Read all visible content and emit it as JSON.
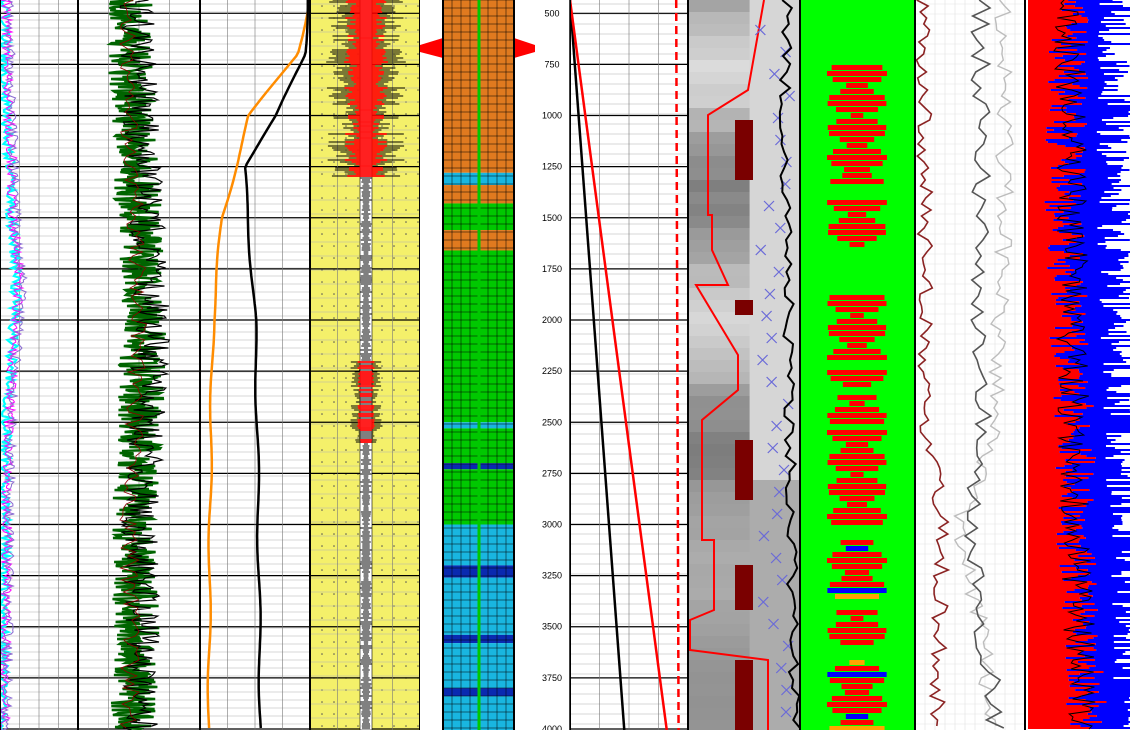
{
  "chart_data": {
    "type": "line",
    "title": "",
    "depth_axis": {
      "ticks": [
        "500",
        "750",
        "1000",
        "1250",
        "1500",
        "1750",
        "2000",
        "2250",
        "2500",
        "2750",
        "3000",
        "3250",
        "3500",
        "3750",
        "4000"
      ],
      "min": 435,
      "max": 4005
    },
    "tracks": [
      {
        "name": "",
        "curve_colors": [
          "#00ffff",
          "#ff00ff",
          "#8a6bd1"
        ],
        "trend": [
          [
            435,
            5
          ],
          [
            1000,
            8
          ],
          [
            1200,
            12
          ],
          [
            1500,
            14
          ],
          [
            1800,
            22
          ],
          [
            2500,
            8
          ],
          [
            3500,
            4
          ],
          [
            4000,
            3
          ]
        ]
      },
      {
        "name": "",
        "curve_colors": [
          "#006400",
          "#000000",
          "#8b0000"
        ],
        "trend": [
          [
            435,
            42
          ],
          [
            1000,
            45
          ],
          [
            1500,
            50
          ],
          [
            2000,
            55
          ],
          [
            2500,
            50
          ],
          [
            3000,
            45
          ],
          [
            3500,
            48
          ],
          [
            4000,
            45
          ]
        ]
      },
      {
        "name": "",
        "curve_colors": [
          "#ff8c00",
          "#000000"
        ],
        "orange": [
          [
            435,
            100
          ],
          [
            700,
            88
          ],
          [
            1000,
            45
          ],
          [
            1500,
            20
          ],
          [
            2000,
            12
          ],
          [
            2500,
            10
          ],
          [
            3000,
            9
          ],
          [
            4000,
            8
          ]
        ],
        "black": [
          [
            435,
            98
          ],
          [
            700,
            95
          ],
          [
            1000,
            70
          ],
          [
            1250,
            40
          ],
          [
            1600,
            45
          ],
          [
            2000,
            50
          ],
          [
            2500,
            52
          ],
          [
            3000,
            53
          ],
          [
            4000,
            55
          ]
        ]
      },
      {
        "name": "",
        "fill": "#f4f06a",
        "curve_colors": [
          "#ff0000",
          "#000000"
        ]
      },
      {
        "name": "",
        "curve_colors": [
          "#e07a1f",
          "#00c800",
          "#19b6e0",
          "#0a2ab0"
        ],
        "lithology": [
          [
            435,
            "#e07a1f"
          ],
          [
            1280,
            "#19b6e0"
          ],
          [
            1340,
            "#e07a1f"
          ],
          [
            1430,
            "#00c800"
          ],
          [
            1560,
            "#e07a1f"
          ],
          [
            1660,
            "#00c800"
          ],
          [
            2500,
            "#19b6e0"
          ],
          [
            2530,
            "#00c800"
          ],
          [
            2700,
            "#0a2ab0"
          ],
          [
            2730,
            "#00c800"
          ],
          [
            3000,
            "#19b6e0"
          ],
          [
            3200,
            "#0a2ab0"
          ],
          [
            3260,
            "#19b6e0"
          ],
          [
            3540,
            "#0a2ab0"
          ],
          [
            3580,
            "#19b6e0"
          ],
          [
            3800,
            "#0a2ab0"
          ],
          [
            3840,
            "#19b6e0"
          ],
          [
            4005,
            "#19b6e0"
          ]
        ]
      },
      {
        "name": "",
        "curve_colors": [
          "#000000",
          "#ff0000"
        ],
        "lines": [
          [
            [
              435,
              0
            ],
            [
              4005,
              0.46
            ]
          ],
          [
            [
              435,
              0
            ],
            [
              4005,
              0.82
            ]
          ],
          [
            [
              435,
              0.9
            ],
            [
              4005,
              0.92
            ]
          ]
        ]
      },
      {
        "name": "",
        "curve_colors": [
          "#ff0000",
          "#000000",
          "#6a6ad8",
          "#8b0000"
        ]
      },
      {
        "name": "",
        "fill": "#00ff00",
        "curve_colors": [
          "#ff0000",
          "#0000ff",
          "#ffa500"
        ]
      },
      {
        "name": "",
        "curve_colors": [
          "#8b2323",
          "#bdbdbd",
          "#555555"
        ]
      },
      {
        "name": "",
        "curve_colors": [
          "#ff0000",
          "#0000ff",
          "#000000"
        ]
      }
    ]
  }
}
